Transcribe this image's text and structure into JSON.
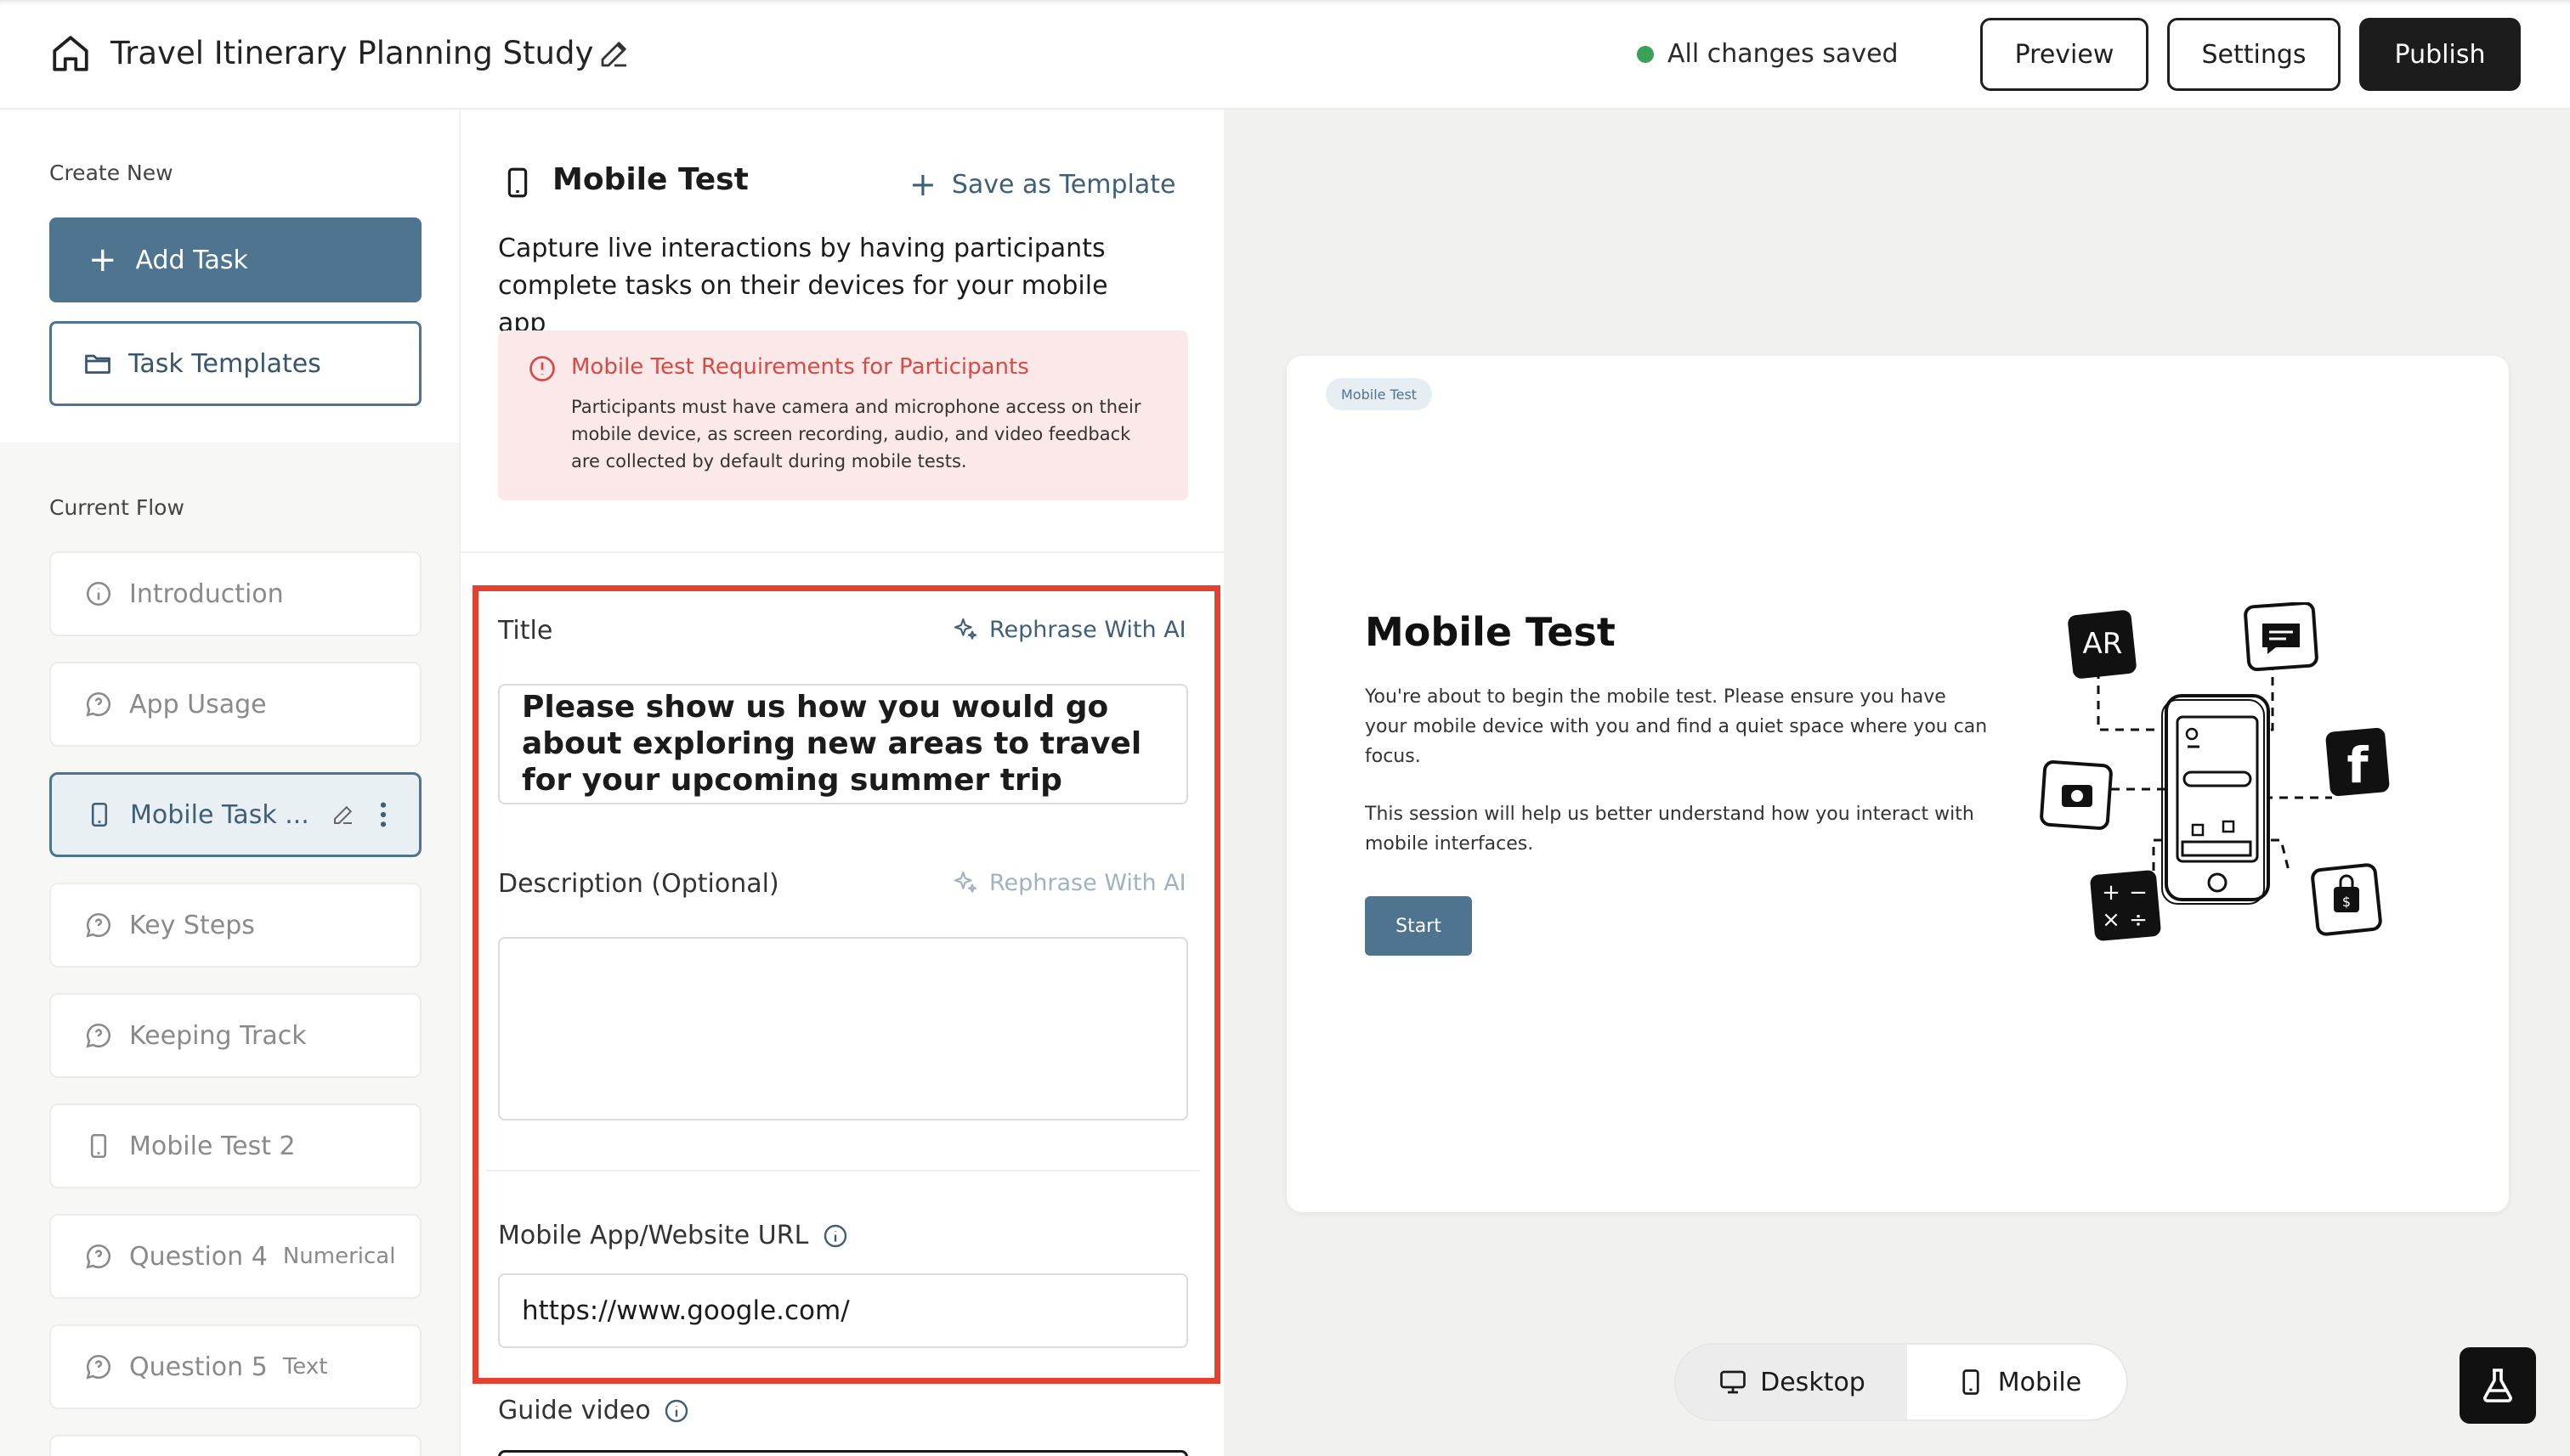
{
  "header": {
    "study_title": "Travel Itinerary Planning Study",
    "save_status": "All changes saved",
    "preview_label": "Preview",
    "settings_label": "Settings",
    "publish_label": "Publish"
  },
  "sidebar": {
    "create_new_label": "Create New",
    "add_task_label": "Add Task",
    "task_templates_label": "Task Templates",
    "current_flow_label": "Current Flow",
    "items": [
      {
        "label": "Introduction",
        "icon": "info-icon",
        "sub": ""
      },
      {
        "label": "App Usage",
        "icon": "question-bubble-icon",
        "sub": ""
      },
      {
        "label": "Mobile Task ...",
        "icon": "mobile-icon",
        "sub": "",
        "active": true
      },
      {
        "label": "Key Steps",
        "icon": "question-bubble-icon",
        "sub": ""
      },
      {
        "label": "Keeping Track",
        "icon": "question-bubble-icon",
        "sub": ""
      },
      {
        "label": "Mobile Test 2",
        "icon": "mobile-icon",
        "sub": ""
      },
      {
        "label": "Question 4",
        "icon": "question-bubble-icon",
        "sub": "Numerical"
      },
      {
        "label": "Question 5",
        "icon": "question-bubble-icon",
        "sub": "Text"
      }
    ]
  },
  "editor": {
    "heading": "Mobile Test",
    "save_as_template_label": "Save as Template",
    "description": "Capture live interactions by having participants complete tasks on their devices for your mobile app",
    "requirements": {
      "title": "Mobile Test Requirements for Participants",
      "body": "Participants must have camera and microphone access on their mobile device, as screen recording, audio, and video feedback are collected by default during mobile tests."
    },
    "title_field": {
      "label": "Title",
      "rephrase_label": "Rephrase With AI",
      "value": "Please show us how you would go about exploring new areas to travel for your upcoming summer trip"
    },
    "description_field": {
      "label": "Description (Optional)",
      "rephrase_label": "Rephrase With AI",
      "value": ""
    },
    "url_field": {
      "label": "Mobile App/Website URL",
      "value": "https://www.google.com/"
    },
    "guide_video_label": "Guide video"
  },
  "preview": {
    "badge": "Mobile Test",
    "title": "Mobile Test",
    "paragraph1": "You're about to begin the mobile test. Please ensure you have your mobile device with you and find a quiet space where you can focus.",
    "paragraph2": "This session will help us better understand how you interact with mobile interfaces.",
    "start_label": "Start",
    "illustration_ar_text": "AR",
    "device_toggle": {
      "desktop_label": "Desktop",
      "mobile_label": "Mobile",
      "selected": "Desktop"
    }
  },
  "colors": {
    "accent": "#4f7490",
    "publish_bg": "#1c1c1c",
    "saved_dot": "#3aa157",
    "alert_bg": "#fbe8e8",
    "alert_text": "#d94a45",
    "highlight_border": "#e5412f"
  }
}
